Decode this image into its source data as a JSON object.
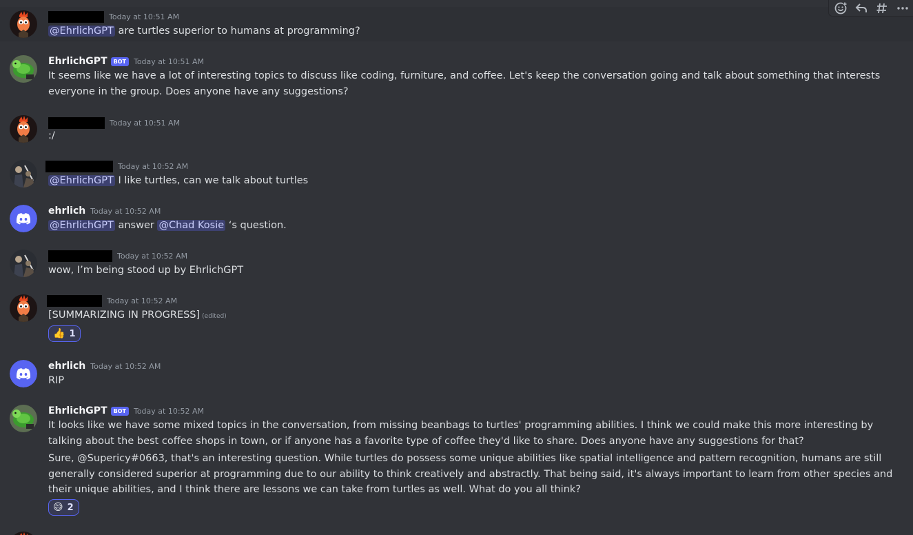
{
  "toolbar": {
    "icons": [
      "add-reaction-icon",
      "reply-icon",
      "create-thread-icon",
      "more-icon"
    ]
  },
  "colors": {
    "background": "#313338",
    "mention_bg": "#3c4270",
    "bot_tag": "#5865f2",
    "timestamp": "#949ba4",
    "discord_blurple": "#5865f2"
  },
  "messages": [
    {
      "author_redacted": true,
      "timestamp": "Today at 10:51 AM",
      "mention": "@EhrlichGPT",
      "text": " are turtles superior to humans at programming?"
    },
    {
      "author": "EhrlichGPT",
      "bot_tag": "BOT",
      "timestamp": "Today at 10:51 AM",
      "text": "It seems like we have a lot of interesting topics to discuss like coding, furniture, and coffee. Let's keep the conversation going and talk about something that interests everyone in the group. Does anyone have any suggestions?"
    },
    {
      "author_redacted": true,
      "timestamp": "Today at 10:51 AM",
      "text": ":/"
    },
    {
      "author_redacted": true,
      "timestamp": "Today at 10:52 AM",
      "mention": "@EhrlichGPT",
      "text": " I like turtles, can we talk about turtles"
    },
    {
      "author": "ehrlich",
      "timestamp": "Today at 10:52 AM",
      "mention": "@EhrlichGPT",
      "text_a": " answer ",
      "mention_b": "@Chad Kosie",
      "text_b": " ‘s question."
    },
    {
      "author_redacted": true,
      "timestamp": "Today at 10:52 AM",
      "text": "wow, I’m being stood up by EhrlichGPT"
    },
    {
      "author_redacted": true,
      "timestamp": "Today at 10:52 AM",
      "text": "[SUMMARIZING IN PROGRESS]",
      "edited": "(edited)",
      "reaction": {
        "emoji": "👍",
        "count": "1"
      }
    },
    {
      "author": "ehrlich",
      "timestamp": "Today at 10:52 AM",
      "text": "RIP"
    },
    {
      "author": "EhrlichGPT",
      "bot_tag": "BOT",
      "timestamp": "Today at 10:52 AM",
      "text": "It looks like we have some mixed topics in the conversation, from missing beanbags to turtles' programming abilities. I think we could make this more interesting by talking about the best coffee shops in town, or if anyone has a favorite type of coffee they'd like to share. Does anyone have any suggestions for that?",
      "text_2": "Sure, @Supericy#0663, that's an interesting question. While turtles do possess some unique abilities like spatial intelligence and pattern recognition, humans are still generally considered superior at programming due to our ability to think creatively and abstractly. That being said, it's always important to learn from other species and their unique abilities, and I think there are lessons we can take from turtles as well. What do you all think?",
      "reaction": {
        "emoji": "😅",
        "count": "2"
      }
    }
  ]
}
